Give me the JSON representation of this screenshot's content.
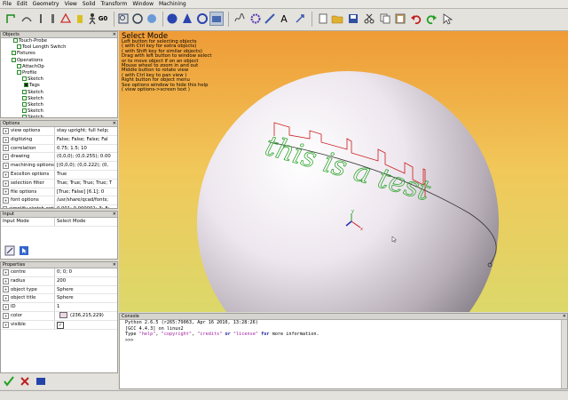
{
  "menubar": {
    "items": [
      "File",
      "Edit",
      "Geometry",
      "View",
      "Solid",
      "Transform",
      "Window",
      "Machining"
    ]
  },
  "toolbar": {
    "buttons": [
      {
        "name": "sketch-tool-icon"
      },
      {
        "name": "arc-tool-icon"
      },
      {
        "name": "line-tool-icon"
      },
      {
        "name": "rect-tool-icon"
      },
      {
        "name": "drill-tool-icon"
      },
      {
        "name": "triangle-tool-icon"
      },
      {
        "name": "person-tool-icon"
      },
      {
        "name": "g0-tool-icon",
        "label": "G0"
      },
      {
        "name": "zoom-tool-icon"
      },
      {
        "name": "fit-view-icon"
      },
      {
        "name": "rotate-view-icon"
      },
      {
        "name": "sphere-tool-icon"
      },
      {
        "name": "cone-tool-icon"
      },
      {
        "name": "cylinder-tool-icon"
      },
      {
        "name": "select-mode-icon"
      },
      {
        "name": "spline-tool-icon"
      },
      {
        "name": "gear-tool-icon"
      },
      {
        "name": "pen-tool-icon"
      },
      {
        "name": "text-tool-icon",
        "label": "A"
      },
      {
        "name": "transform-tool-icon"
      },
      {
        "name": "new-file-icon"
      },
      {
        "name": "open-folder-icon"
      },
      {
        "name": "save-icon"
      },
      {
        "name": "cut-icon"
      },
      {
        "name": "copy-icon"
      },
      {
        "name": "paste-icon"
      },
      {
        "name": "undo-icon"
      },
      {
        "name": "redo-icon"
      },
      {
        "name": "pointer-icon"
      }
    ]
  },
  "objects_panel": {
    "title": "Objects",
    "rows": [
      {
        "label": "Touch-Probe",
        "indent": 14
      },
      {
        "label": "Tool Length Switch",
        "indent": 18
      },
      {
        "label": "Fixtures",
        "indent": 12
      },
      {
        "label": "Operations",
        "indent": 12
      },
      {
        "label": "AttachOp",
        "indent": 18
      },
      {
        "label": "Profile",
        "indent": 18
      },
      {
        "label": "Sketch",
        "indent": 24
      },
      {
        "label": "Tags",
        "indent": 26
      },
      {
        "label": "Sketch",
        "indent": 24
      },
      {
        "label": "Sketch",
        "indent": 24
      },
      {
        "label": "Sketch",
        "indent": 24
      },
      {
        "label": "Sketch",
        "indent": 24
      },
      {
        "label": "Sketch",
        "indent": 24
      }
    ]
  },
  "options_panel": {
    "title": "Options",
    "rows": [
      {
        "k": "view options",
        "v": "stay upright; full help;"
      },
      {
        "k": "digitizing",
        "v": "False; False; False; Fal"
      },
      {
        "k": "correlation",
        "v": "0.75; 1.5; 10"
      },
      {
        "k": "drawing",
        "v": "(0,0,0); (0,0.255); 0.00"
      },
      {
        "k": "machining options",
        "v": "[(0,0,0); (0,0.222); (0,"
      },
      {
        "k": "Excellon options",
        "v": "True"
      },
      {
        "k": "selection filter",
        "v": "True; True; True; True; T"
      },
      {
        "k": "file options",
        "v": "[True; False] [6.1]; 0"
      },
      {
        "k": "font options",
        "v": "/usr/share/qcad/fonts;"
      },
      {
        "k": "simplify sketch option",
        "v": "0.001; 0.000001; 3; 8;"
      }
    ]
  },
  "input_panel": {
    "title": "Input",
    "rows": [
      {
        "k": "Input Mode",
        "v": "Select Mode"
      }
    ]
  },
  "properties_panel": {
    "title": "Properties",
    "rows": [
      {
        "k": "centre",
        "v": "0; 0; 0"
      },
      {
        "k": "radius",
        "v": "200"
      },
      {
        "k": "object type",
        "v": "Sphere"
      },
      {
        "k": "object title",
        "v": "Sphere"
      },
      {
        "k": "ID",
        "v": "1"
      },
      {
        "k": "color",
        "v": "(236,215,229)"
      },
      {
        "k": "visible",
        "v": ""
      }
    ]
  },
  "viewport": {
    "mode_title": "Select Mode",
    "help_lines": [
      "Left button for selecting objects",
      "( with Ctrl key for extra objects)",
      "( with Shift key for similar objects)",
      "Drag with left button to window select",
      "or to move object if on an object",
      "Mouse wheel to zoom in and out",
      "Middle button to rotate view",
      "( with Ctrl key to pan view )",
      "Right button for object menu",
      "See options window to hide this help",
      "( view options->screen text )"
    ],
    "engraved_text": "this is a test"
  },
  "console": {
    "title": "Console",
    "lines": [
      "Python 2.6.5 (r265:79063, Apr 16 2010, 13:28:26)",
      "[GCC 4.4.3] on linux2"
    ],
    "help_line": {
      "pre": "Type ",
      "a": "\"help\"",
      "c1": ", ",
      "b": "\"copyright\"",
      "c2": ", ",
      "c": "\"credits\"",
      "or": " or ",
      "d": "\"license\"",
      "for": " for",
      "post": " more information."
    },
    "prompt": ">>>"
  },
  "colors": {
    "sphere_color": "#ecd7e5",
    "accent": "#3355aa"
  }
}
